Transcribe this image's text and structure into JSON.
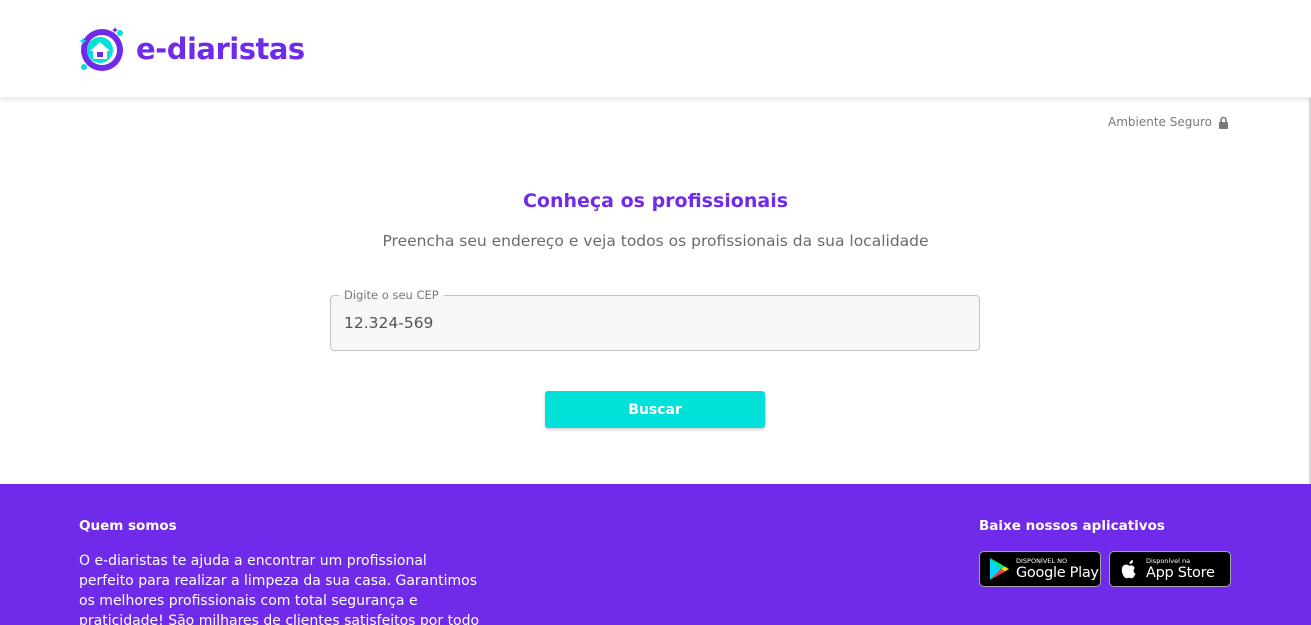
{
  "header": {
    "brand": "e-diaristas"
  },
  "security": {
    "label": "Ambiente Seguro",
    "icon": "lock-icon"
  },
  "main": {
    "title": "Conheça os profissionais",
    "subtitle": "Preencha seu endereço e veja todos os profissionais da sua localidade",
    "cep_field": {
      "label": "Digite o seu CEP",
      "value": "12.324-569"
    },
    "search_button": "Buscar"
  },
  "footer": {
    "about_title": "Quem somos",
    "about_text": "O e-diaristas te ajuda a encontrar um profissional perfeito para realizar a limpeza da sua casa. Garantimos os melhores profissionais com total segurança e praticidade! São milhares de clientes satisfeitos por todo",
    "apps_title": "Baixe nossos aplicativos",
    "google_play": {
      "small": "DISPONÍVEL NO",
      "big": "Google Play"
    },
    "app_store": {
      "small": "Disponível na",
      "big": "App Store"
    }
  },
  "colors": {
    "brand_purple": "#6f2be9",
    "accent_cyan": "#00e1d9"
  }
}
